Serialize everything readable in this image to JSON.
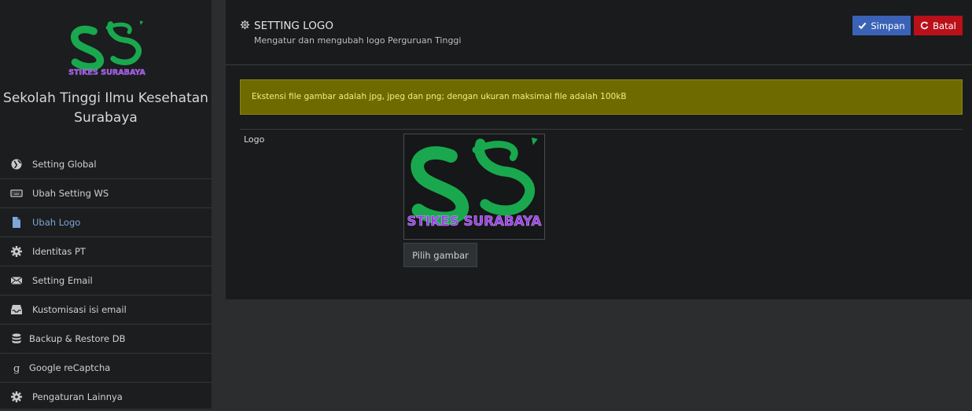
{
  "sidebar": {
    "logo_text": "STIKES SURABAYA",
    "brand_line1": "Sekolah Tinggi Ilmu Kesehatan",
    "brand_line2": "Surabaya",
    "items": [
      {
        "label": "Setting Global",
        "icon": "globe-icon"
      },
      {
        "label": "Ubah Setting WS",
        "icon": "keyboard-icon"
      },
      {
        "label": "Ubah Logo",
        "icon": "file-icon",
        "active": true
      },
      {
        "label": "Identitas PT",
        "icon": "gear-icon"
      },
      {
        "label": "Setting Email",
        "icon": "envelope-icon"
      },
      {
        "label": "Kustomisasi isi email",
        "icon": "inbox-icon"
      },
      {
        "label": "Backup & Restore DB",
        "icon": "database-icon"
      },
      {
        "label": "Google reCaptcha",
        "icon": "google-icon"
      },
      {
        "label": "Pengaturan Lainnya",
        "icon": "gear-icon"
      }
    ]
  },
  "header": {
    "title": "SETTING LOGO",
    "subtitle": "Mengatur dan mengubah logo Perguruan Tinggi",
    "save_label": "Simpan",
    "cancel_label": "Batal"
  },
  "alert": {
    "text": "Ekstensi file gambar adalah jpg, jpeg dan png; dengan ukuran maksimal file adalah 100kB"
  },
  "form": {
    "logo_label": "Logo",
    "logo_text": "STIKES SURABAYA",
    "pick_label": "Pilih gambar"
  },
  "colors": {
    "logo_green": "#19a84e",
    "logo_purple": "#9b3fe0",
    "save_blue": "#3a62b7",
    "cancel_red": "#b9101a",
    "alert_bg": "#6f6a00",
    "active_link": "#7fa6d8"
  }
}
